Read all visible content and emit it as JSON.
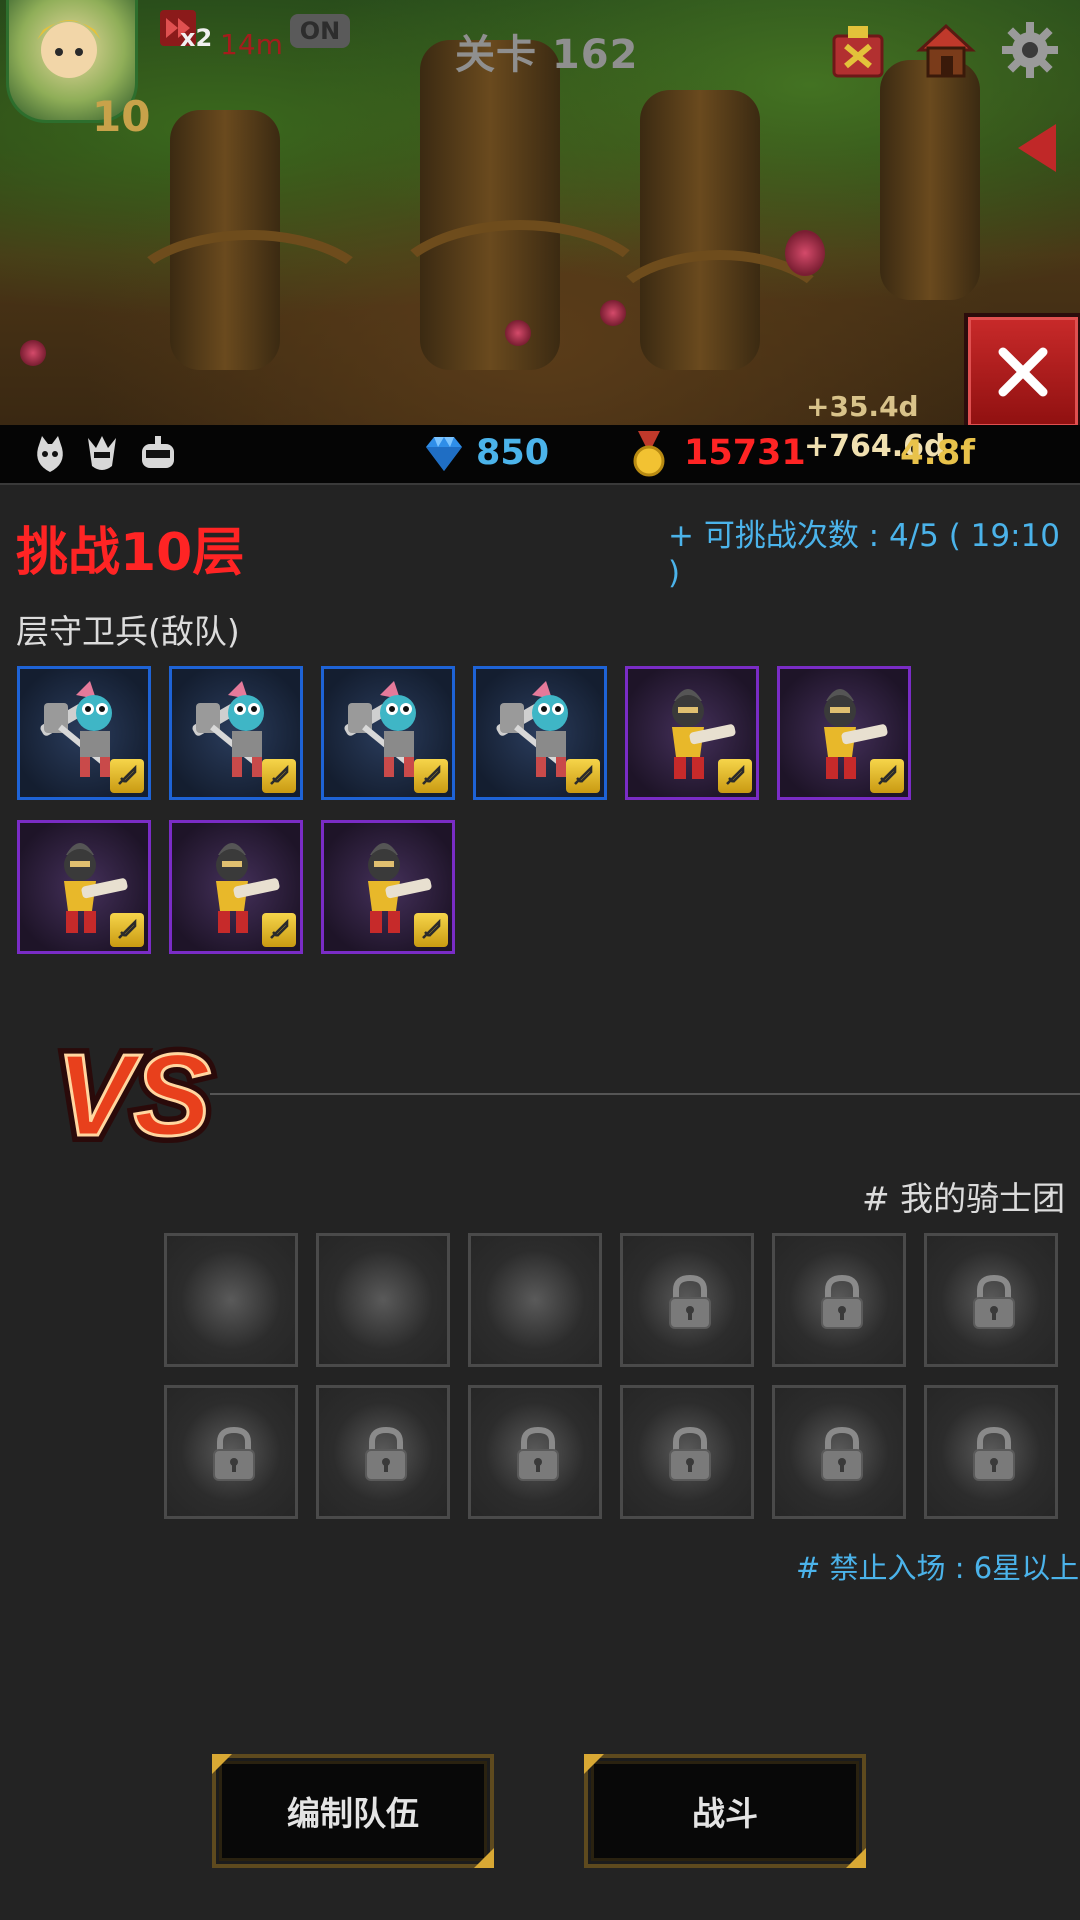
{
  "header": {
    "stage_label": "关卡 162",
    "player_level": "10",
    "speed_badge": "x2",
    "timer": "14m",
    "auto_toggle": "ON",
    "floating_text_1": "+35.4d",
    "floating_text_2": "+764.6d",
    "floating_text_3": "4.8f"
  },
  "resources": {
    "gems": "850",
    "medals": "15731"
  },
  "challenge": {
    "title": "挑战10层",
    "attempts": "+ 可挑战次数 : 4/5 ( 19:10 )",
    "guard_label": "层守卫兵(敌队)",
    "enemy_units": [
      {
        "rarity": "blue",
        "type": "skeleton-hammer"
      },
      {
        "rarity": "blue",
        "type": "skeleton-hammer"
      },
      {
        "rarity": "blue",
        "type": "skeleton-hammer"
      },
      {
        "rarity": "blue",
        "type": "skeleton-hammer"
      },
      {
        "rarity": "purple",
        "type": "red-knight-cannon"
      },
      {
        "rarity": "purple",
        "type": "red-knight-cannon"
      },
      {
        "rarity": "purple",
        "type": "red-knight-cannon"
      },
      {
        "rarity": "purple",
        "type": "red-knight-cannon"
      },
      {
        "rarity": "purple",
        "type": "red-knight-cannon"
      }
    ]
  },
  "vs_label": "VS",
  "my_team": {
    "label": "# 我的骑士团",
    "slots": [
      "empty",
      "empty",
      "empty",
      "locked",
      "locked",
      "locked",
      "locked",
      "locked",
      "locked",
      "locked",
      "locked",
      "locked"
    ],
    "restriction": "# 禁止入场 : 6星以上"
  },
  "buttons": {
    "edit_team": "编制队伍",
    "battle": "战斗"
  },
  "colors": {
    "title_red": "#ff2424",
    "info_blue": "#4bb3ea",
    "rarity_blue": "#1e63d6",
    "rarity_purple": "#7a2cc6",
    "gold": "#d8a834"
  }
}
